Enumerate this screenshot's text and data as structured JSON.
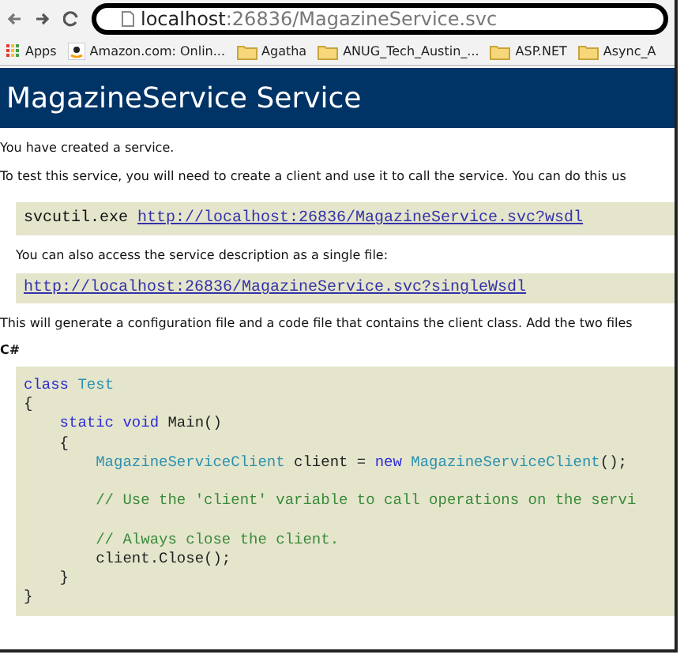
{
  "toolbar": {
    "address": {
      "host": "localhost",
      "path": ":26836/MagazineService.svc"
    }
  },
  "bookmarks": [
    {
      "label": "Apps",
      "kind": "apps"
    },
    {
      "label": "Amazon.com: Onlin...",
      "kind": "site"
    },
    {
      "label": "Agatha",
      "kind": "folder"
    },
    {
      "label": "ANUG_Tech_Austin_...",
      "kind": "folder"
    },
    {
      "label": "ASP.NET",
      "kind": "folder"
    },
    {
      "label": "Async_A",
      "kind": "folder"
    }
  ],
  "page": {
    "heading": "MagazineService Service",
    "intro": "You have created a service.",
    "instructions": "To test this service, you will need to create a client and use it to call the service. You can do this us",
    "command": {
      "program": "svcutil.exe",
      "link": "http://localhost:26836/MagazineService.svc?wsdl"
    },
    "single_file_note": "You can also access the service description as a single file:",
    "single_file_link": "http://localhost:26836/MagazineService.svc?singleWsdl",
    "generate_note": "This will generate a configuration file and a code file that contains the client class. Add the two files",
    "language": "C#",
    "code_lines": [
      {
        "kind": "code",
        "tokens": [
          {
            "kind": "keyword",
            "text": "class"
          },
          {
            "kind": "type",
            "text": " Test"
          }
        ]
      },
      {
        "kind": "code",
        "tokens": [
          {
            "kind": "plain",
            "text": "{"
          }
        ]
      },
      {
        "kind": "code",
        "tokens": [
          {
            "kind": "keyword",
            "text": "    static void"
          },
          {
            "kind": "plain",
            "text": " Main()"
          }
        ]
      },
      {
        "kind": "code",
        "tokens": [
          {
            "kind": "plain",
            "text": "    {"
          }
        ]
      },
      {
        "kind": "code",
        "tokens": [
          {
            "kind": "type",
            "text": "        MagazineServiceClient"
          },
          {
            "kind": "plain",
            "text": " client = "
          },
          {
            "kind": "keyword",
            "text": "new"
          },
          {
            "kind": "type",
            "text": " MagazineServiceClient"
          },
          {
            "kind": "plain",
            "text": "();"
          }
        ]
      },
      {
        "kind": "blank"
      },
      {
        "kind": "code",
        "tokens": [
          {
            "kind": "comment",
            "text": "        // Use the 'client' variable to call operations on the servi"
          }
        ]
      },
      {
        "kind": "blank"
      },
      {
        "kind": "code",
        "tokens": [
          {
            "kind": "comment",
            "text": "        // Always close the client."
          }
        ]
      },
      {
        "kind": "code",
        "tokens": [
          {
            "kind": "plain",
            "text": "        client.Close();"
          }
        ]
      },
      {
        "kind": "code",
        "tokens": [
          {
            "kind": "plain",
            "text": "    }"
          }
        ]
      },
      {
        "kind": "code",
        "tokens": [
          {
            "kind": "plain",
            "text": "}"
          }
        ]
      }
    ]
  }
}
